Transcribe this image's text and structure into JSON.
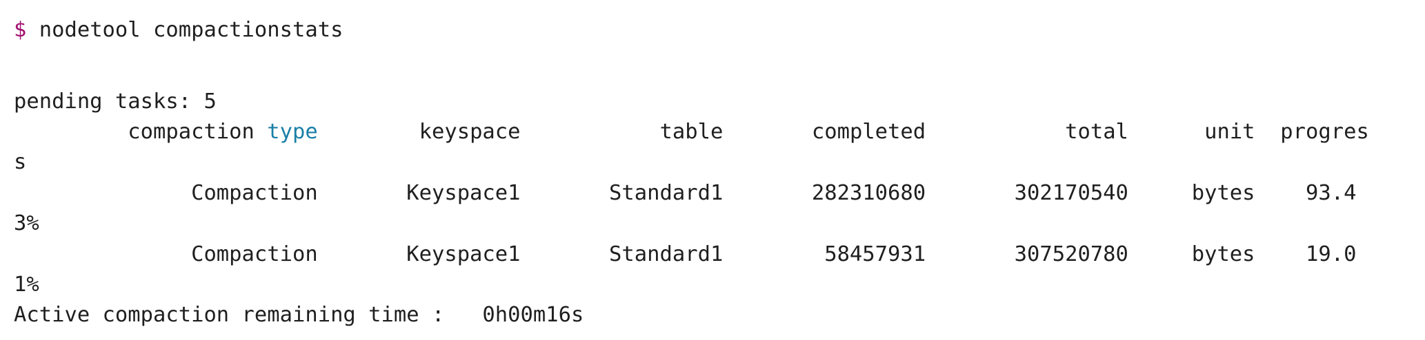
{
  "prompt": {
    "symbol": "$",
    "command": " nodetool compactionstats"
  },
  "pending_line": "pending tasks: 5",
  "header": {
    "before_keyword": "         compaction ",
    "keyword": "type",
    "after_keyword": "        keyspace           table       completed           total      unit  progres",
    "wrap": "s"
  },
  "rows": [
    {
      "text": "              Compaction       Keyspace1       Standard1       282310680       302170540     bytes    93.4",
      "wrap": "3%"
    },
    {
      "text": "              Compaction       Keyspace1       Standard1        58457931       307520780     bytes    19.0",
      "wrap": "1%"
    }
  ],
  "active_line": "Active compaction remaining time :   0h00m16s",
  "colors": {
    "prompt_symbol": "#a3106f",
    "keyword": "#1a7fa6",
    "text": "#1f1f1f",
    "background": "#ffffff"
  }
}
